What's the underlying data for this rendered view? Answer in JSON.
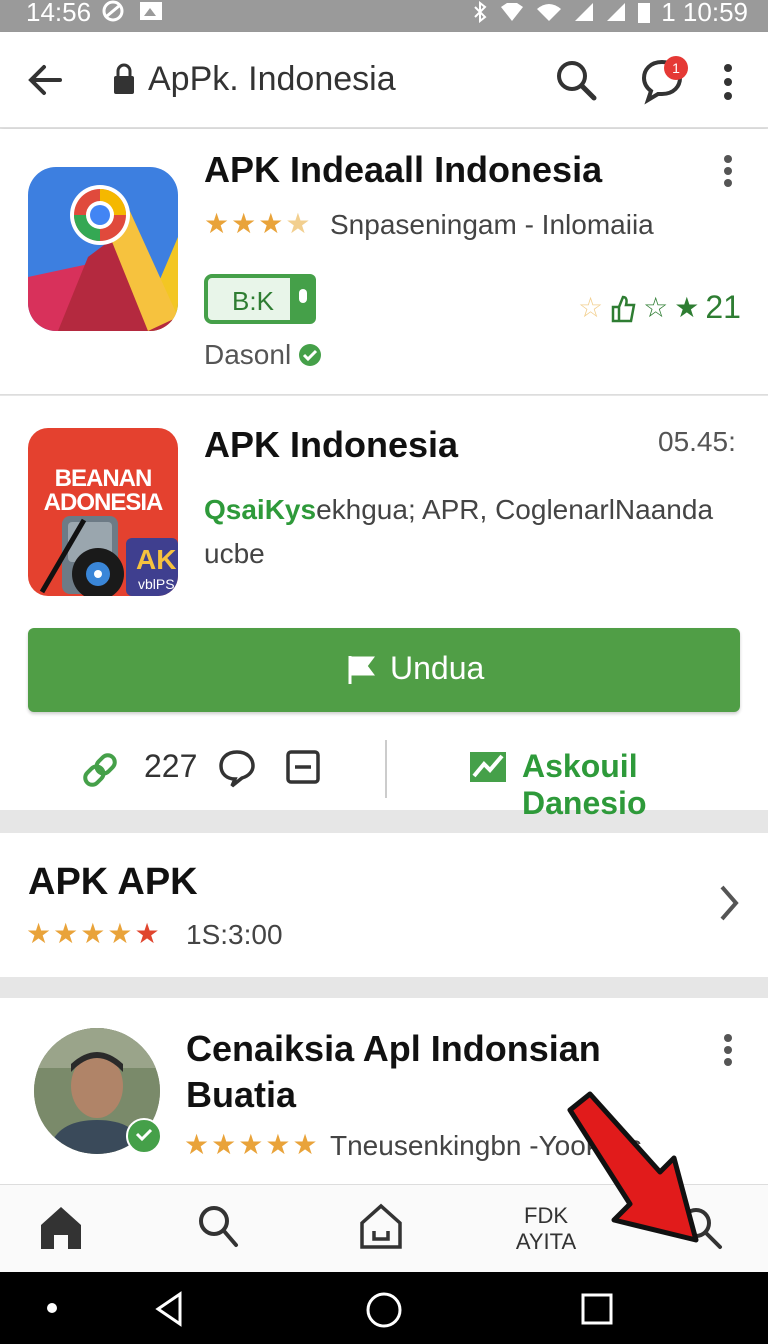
{
  "status_bar": {
    "time_left": "14:56",
    "time_right": "1 10:59"
  },
  "app_bar": {
    "title": "ApPk. Indonesia",
    "notification_count": "1"
  },
  "card1": {
    "title": "APK Indeaall Indonesia",
    "rating_meta": "Snpaseningam - Inlomaiia",
    "toggle_label": "B:K",
    "developer": "Dasonl",
    "count": "21",
    "rating_value": 3.5
  },
  "card2": {
    "title": "APK Indonesia",
    "time": "05.45:",
    "icon_text_1": "BEANAN",
    "icon_text_2": "ADONESIA",
    "icon_text_ak": "AK",
    "icon_text_sub": "vblPS",
    "desc_green": "QsaiKys",
    "desc_rest": "ekhgua; APR, CoglenarlNaanda",
    "desc_line2": "ucbe",
    "install_label": "Undua",
    "link_count": "227",
    "right_action": "Askouil Danesio"
  },
  "card3": {
    "title": "APK APK",
    "meta": "1S:3:00",
    "rating_value": 4.5
  },
  "card4": {
    "title_line1": "Cenaiksia Apl Indonsian",
    "title_line2": "Buatia",
    "meta": "Tneusenkingbn -Yookeils",
    "rating_value": 4.5
  },
  "bottom_nav": {
    "item4_line1": "FDK",
    "item4_line2": "AYITA"
  },
  "colors": {
    "accent_green": "#509e46",
    "star": "#e9a33a",
    "badge_red": "#e53935"
  },
  "icons": [
    "back-arrow-icon",
    "lock-icon",
    "search-icon",
    "chat-icon",
    "more-vert-icon",
    "link-icon",
    "comment-icon",
    "minus-box-icon",
    "chevron-right-icon",
    "home-icon",
    "house-icon",
    "verified-icon",
    "flag-icon"
  ]
}
